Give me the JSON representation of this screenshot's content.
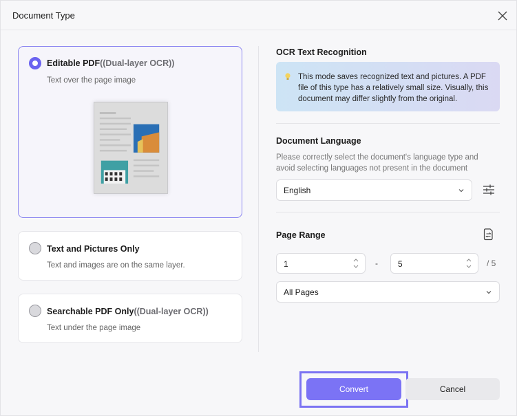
{
  "dialog": {
    "title": "Document Type",
    "close_icon": "close-icon"
  },
  "options": [
    {
      "title": "Editable PDF",
      "suffix": "((Dual-layer OCR))",
      "subtitle": "Text over the page image",
      "selected": true
    },
    {
      "title": "Text and Pictures Only",
      "suffix": "",
      "subtitle": "Text and images are on the same layer.",
      "selected": false
    },
    {
      "title": "Searchable PDF Only",
      "suffix": "((Dual-layer OCR))",
      "subtitle": "Text under the page image",
      "selected": false
    }
  ],
  "ocr": {
    "title": "OCR Text Recognition",
    "info_icon": "lightbulb-icon",
    "info": "This mode saves recognized text and pictures. A PDF file of this type has a relatively small size. Visually, this document may differ slightly from the original."
  },
  "language": {
    "title": "Document Language",
    "hint": "Please correctly select the document's language type and avoid selecting languages not present in the document",
    "selected": "English",
    "settings_icon": "sliders-icon"
  },
  "page_range": {
    "title": "Page Range",
    "icon": "page-swap-icon",
    "from": "1",
    "separator": "-",
    "to": "5",
    "total": "/ 5",
    "scope": "All Pages"
  },
  "footer": {
    "convert_label": "Convert",
    "cancel_label": "Cancel"
  },
  "colors": {
    "accent": "#7b73f5",
    "selected_border": "#8b86f0"
  }
}
